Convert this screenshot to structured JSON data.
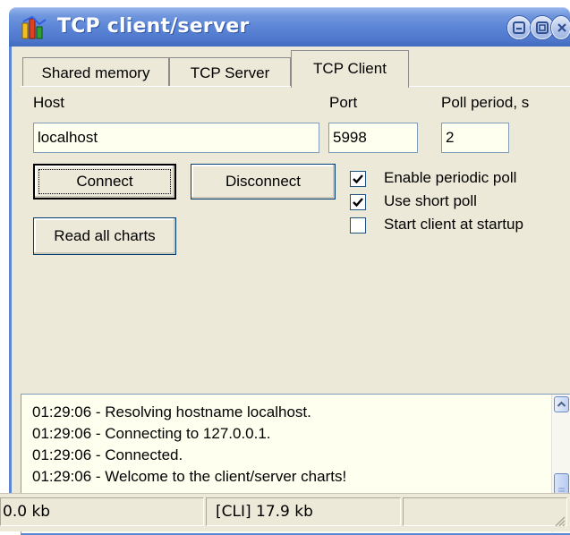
{
  "window": {
    "title": "TCP client/server",
    "controls": [
      "minimize-icon",
      "maximize-icon",
      "close-icon"
    ]
  },
  "tabs": [
    {
      "label": "Shared memory",
      "active": false
    },
    {
      "label": "TCP Server",
      "active": false
    },
    {
      "label": "TCP Client",
      "active": true
    }
  ],
  "form": {
    "host_label": "Host",
    "host_value": "localhost",
    "port_label": "Port",
    "port_value": "5998",
    "poll_label": "Poll period, s",
    "poll_value": "2"
  },
  "buttons": {
    "connect": "Connect",
    "disconnect": "Disconnect",
    "read_all": "Read all charts"
  },
  "checkboxes": [
    {
      "label": "Enable periodic poll",
      "checked": true
    },
    {
      "label": "Use short poll",
      "checked": true
    },
    {
      "label": "Start client at startup",
      "checked": false
    }
  ],
  "log": [
    "01:29:06 - Resolving hostname localhost.",
    "01:29:06 - Connecting to 127.0.0.1.",
    "01:29:06 - Connected.",
    "01:29:06 - Welcome to the client/server charts!"
  ],
  "status": {
    "left": "0.0 kb",
    "middle": "[CLI] 17.9 kb",
    "right": ""
  },
  "colors": {
    "titlebar": "#5b85d6",
    "face": "#ece9d8",
    "input_bg": "#fffff0"
  }
}
